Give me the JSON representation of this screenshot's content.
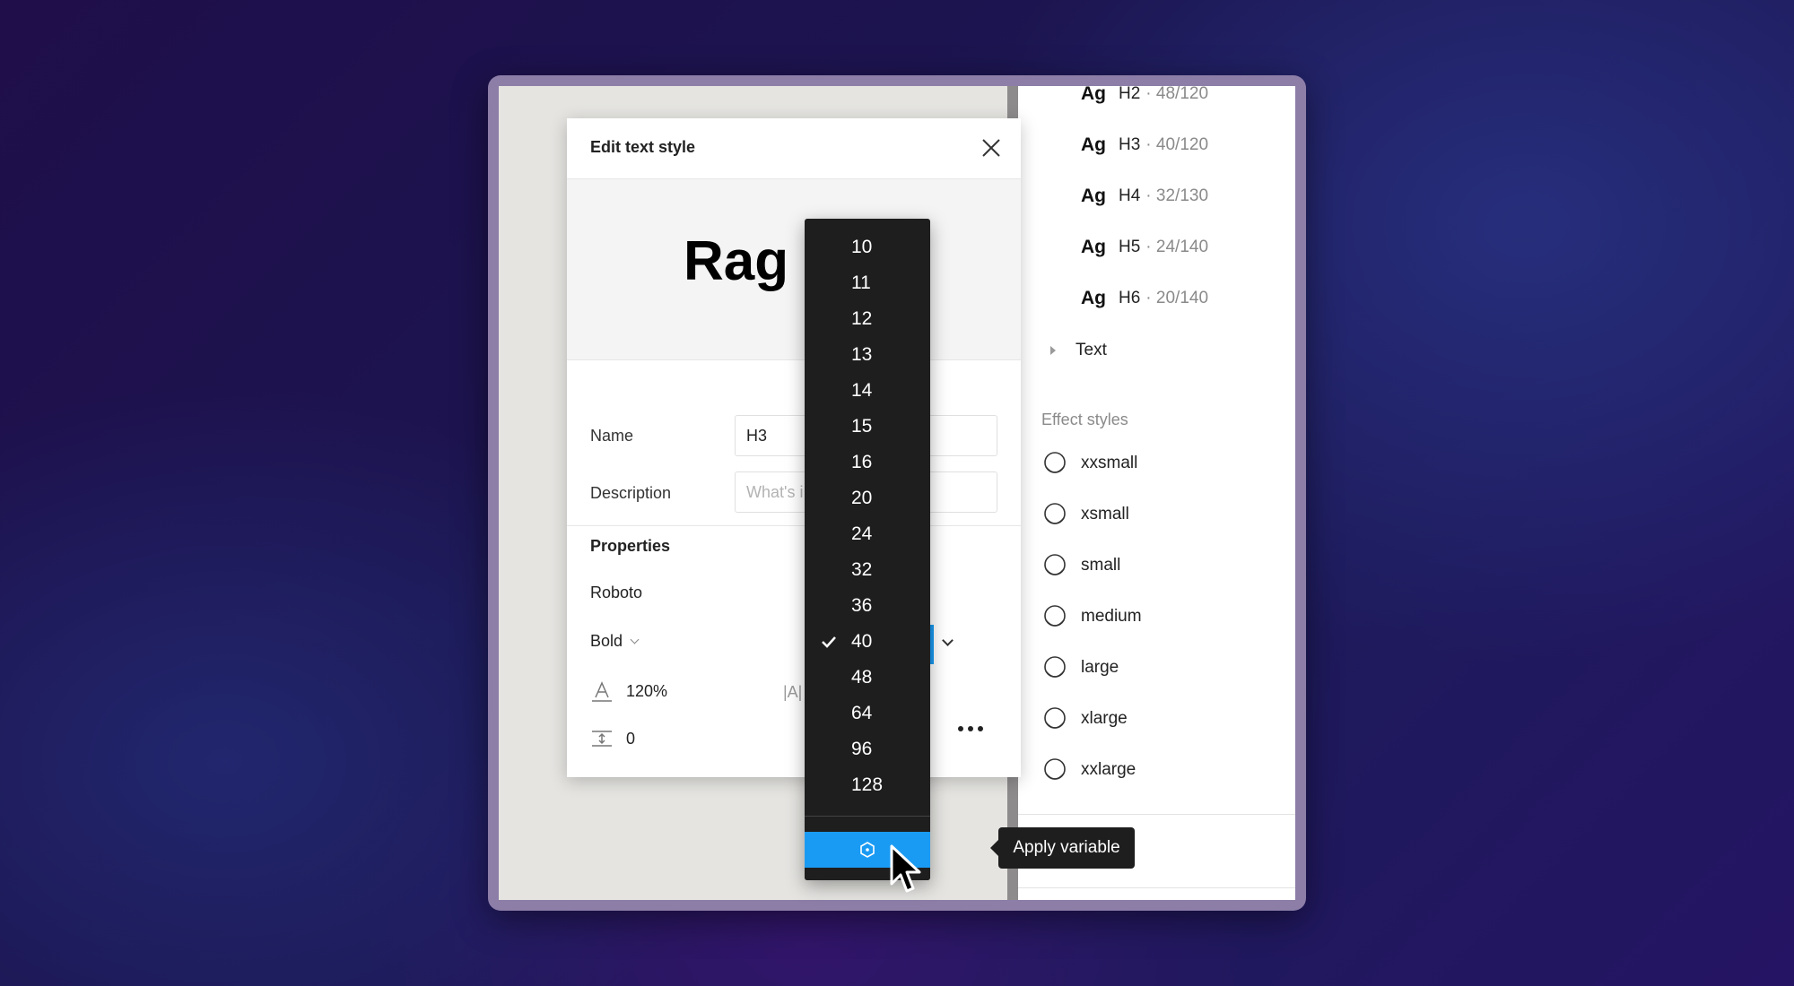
{
  "dialog": {
    "title": "Edit text style",
    "preview_text": "Rag 1",
    "name_label": "Name",
    "name_value": "H3",
    "description_label": "Description",
    "description_placeholder": "What's i",
    "properties_label": "Properties",
    "font_family": "Roboto",
    "font_weight": "Bold",
    "line_height": "120%",
    "letter_spacing_glyph": "|A|",
    "paragraph_spacing": "0"
  },
  "size_dropdown": {
    "options": [
      "10",
      "11",
      "12",
      "13",
      "14",
      "15",
      "16",
      "20",
      "24",
      "32",
      "36",
      "40",
      "48",
      "64",
      "96",
      "128"
    ],
    "selected": "40"
  },
  "tooltip": {
    "text": "Apply variable"
  },
  "right_panel": {
    "text_styles": [
      {
        "ag": "Ag",
        "name": "H2",
        "size": "· 48/120"
      },
      {
        "ag": "Ag",
        "name": "H3",
        "size": "· 40/120"
      },
      {
        "ag": "Ag",
        "name": "H4",
        "size": "· 32/130"
      },
      {
        "ag": "Ag",
        "name": "H5",
        "size": "· 24/140"
      },
      {
        "ag": "Ag",
        "name": "H6",
        "size": "· 20/140"
      }
    ],
    "text_group": "Text",
    "effect_styles_title": "Effect styles",
    "effect_styles": [
      "xxsmall",
      "xsmall",
      "small",
      "medium",
      "large",
      "xlarge",
      "xxlarge"
    ]
  },
  "colors": {
    "accent": "#1a9bf3",
    "dropdown_bg": "#1e1e1e",
    "frame": "#8d7ea8"
  }
}
